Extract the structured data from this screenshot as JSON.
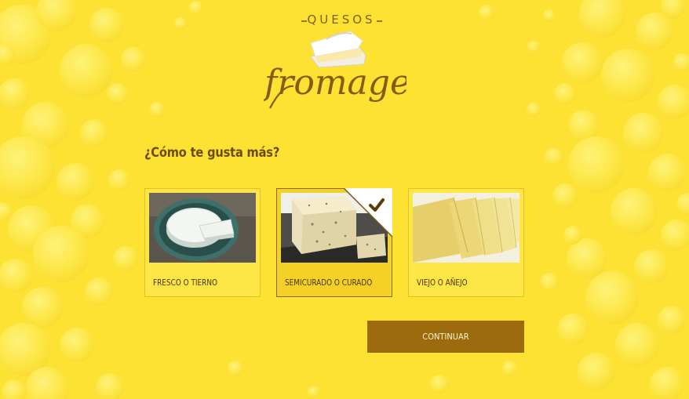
{
  "brand": {
    "top_word": "QUESOS",
    "script_word": "fromage",
    "color": "#8a5a0c"
  },
  "question": "¿Cómo te gusta más?",
  "options": [
    {
      "label": "FRESCO O TIERNO",
      "selected": false
    },
    {
      "label": "SEMICURADO O CURADO",
      "selected": true
    },
    {
      "label": "VIEJO O AÑEJO",
      "selected": false
    }
  ],
  "continue_label": "CONTINUAR",
  "colors": {
    "background": "#fde233",
    "accent": "#9c6b0e",
    "text": "#6d4a06"
  },
  "icons": {
    "selected_mark": "check-icon"
  }
}
